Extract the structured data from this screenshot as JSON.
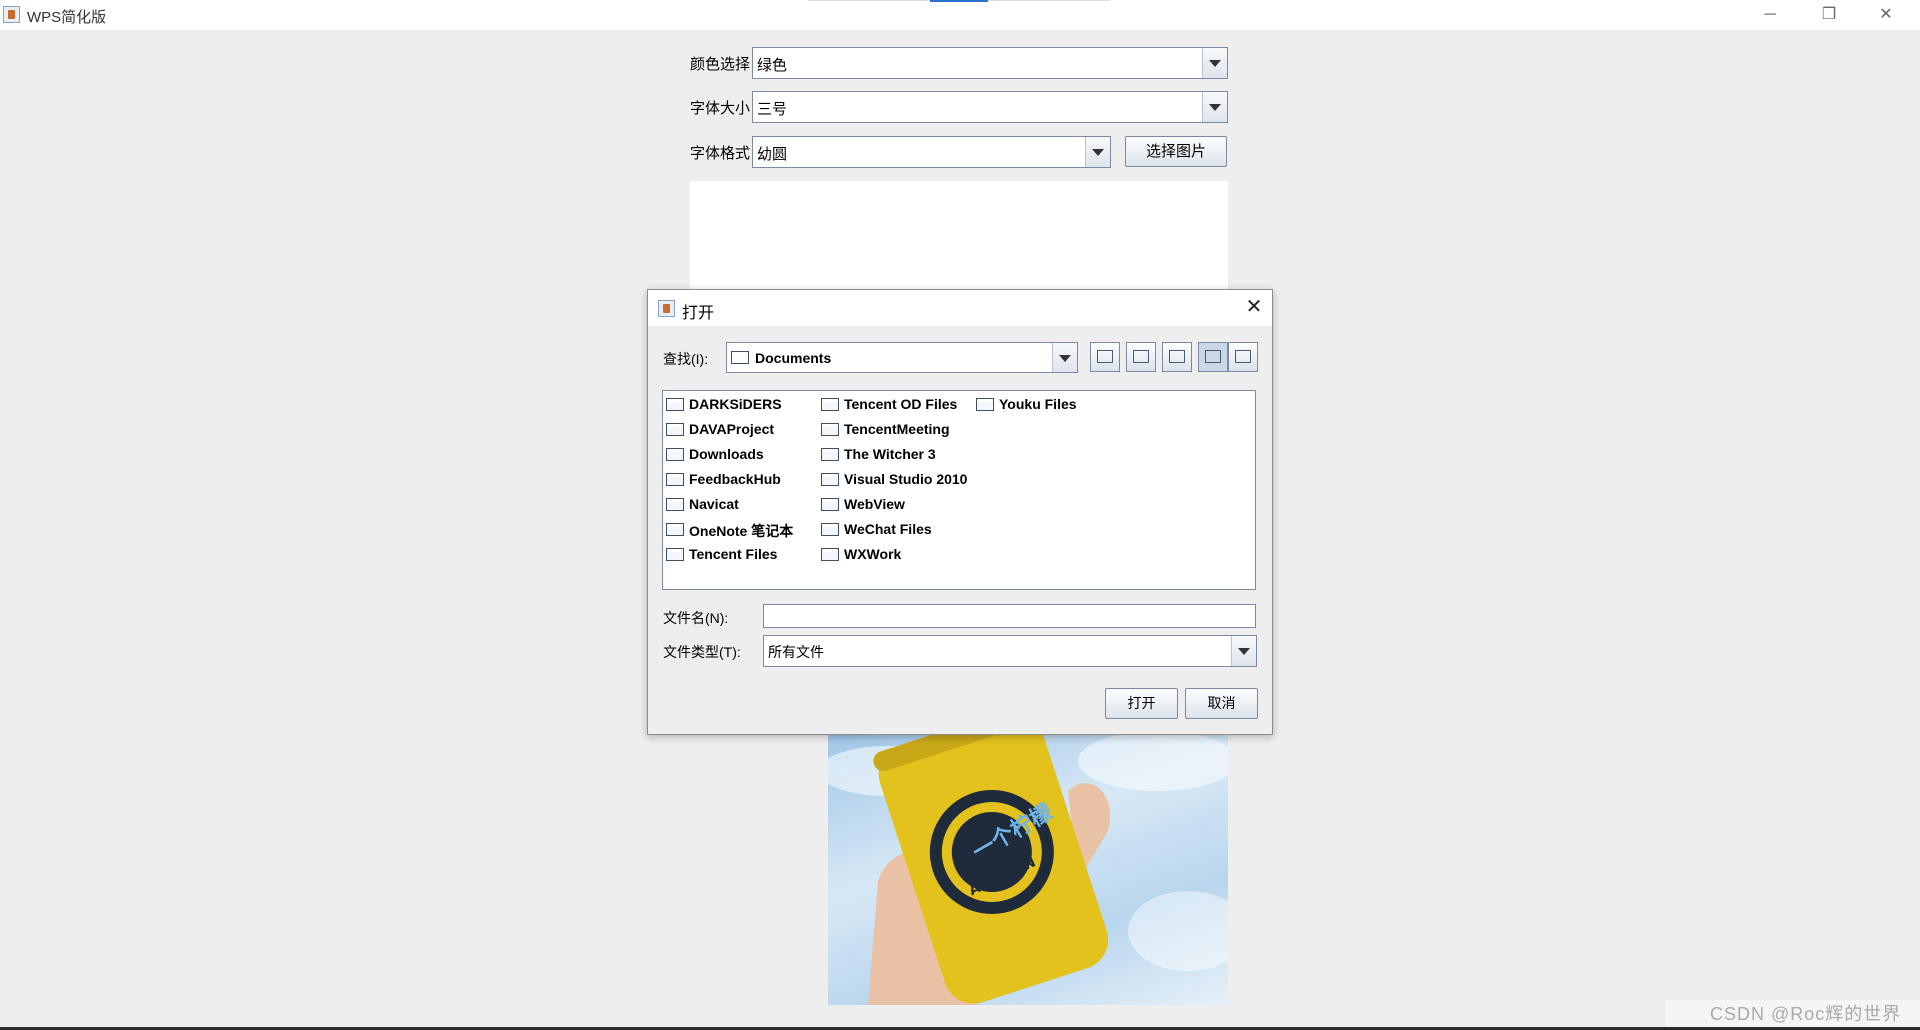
{
  "window": {
    "title": "WPS简化版",
    "minimize_glyph": "─",
    "maximize_glyph": "❐",
    "close_glyph": "✕"
  },
  "form": {
    "color_label": "颜色选择",
    "color_value": "绿色",
    "size_label": "字体大小",
    "size_value": "三号",
    "font_label": "字体格式",
    "font_value": "幼圆",
    "choose_image_button": "选择图片"
  },
  "dialog": {
    "title": "打开",
    "close_glyph": "✕",
    "look_in_label": "查找(I):",
    "look_in_value": "Documents",
    "toolbar_icons": [
      "up-folder-icon",
      "home-icon",
      "new-folder-icon",
      "list-view-icon",
      "details-view-icon"
    ],
    "files": [
      "DARKSiDERS",
      "DAVAProject",
      "Downloads",
      "FeedbackHub",
      "Navicat",
      "OneNote 笔记本",
      "Tencent Files",
      "Tencent OD Files",
      "TencentMeeting",
      "The Witcher 3",
      "Visual Studio 2010",
      "WebView",
      "WeChat Files",
      "WXWork",
      "Youku Files"
    ],
    "filename_label": "文件名(N):",
    "filename_value": "",
    "filetype_label": "文件类型(T):",
    "filetype_value": "所有文件",
    "open_button": "打开",
    "cancel_button": "取消"
  },
  "image": {
    "can_text": "一个柠檬",
    "can_subtext": "A LEMON"
  },
  "watermark": "CSDN @Roc辉的世界"
}
